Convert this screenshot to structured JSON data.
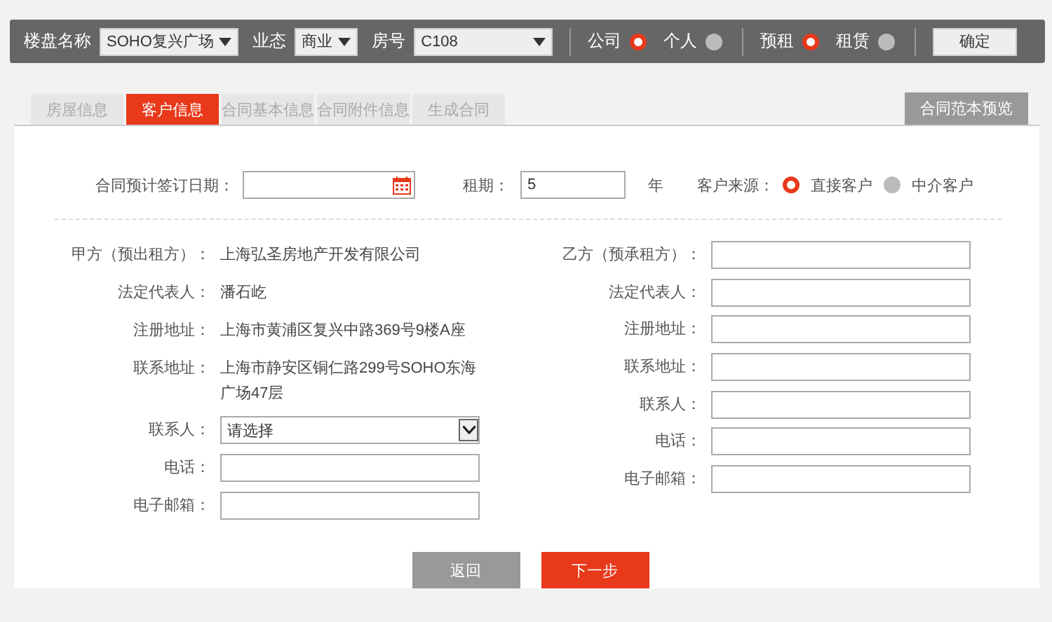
{
  "toolbar": {
    "fields": [
      {
        "label": "楼盘名称",
        "value": "SOHO复兴广场"
      },
      {
        "label": "业态",
        "value": "商业"
      },
      {
        "label": "房号",
        "value": "C108"
      }
    ],
    "radio_groups": [
      [
        {
          "label": "公司",
          "selected": true
        },
        {
          "label": "个人",
          "selected": false
        }
      ],
      [
        {
          "label": "预租",
          "selected": true
        },
        {
          "label": "租赁",
          "selected": false
        }
      ]
    ],
    "confirm_button": "确定"
  },
  "tabs": [
    {
      "label": "房屋信息",
      "selected": false
    },
    {
      "label": "客户信息",
      "selected": true
    },
    {
      "label": "合同基本信息",
      "selected": false
    },
    {
      "label": "合同附件信息",
      "selected": false
    },
    {
      "label": "生成合同",
      "selected": false
    }
  ],
  "preview_button": "合同范本预览",
  "form": {
    "date_label": "合同预计签订日期：",
    "term_label": "租期：",
    "term_value": "5",
    "term_unit": "年",
    "source_label": "客户来源：",
    "source_options": [
      {
        "label": "直接客户",
        "selected": true
      },
      {
        "label": "中介客户",
        "selected": false
      }
    ]
  },
  "party_a": [
    {
      "kind": "text",
      "label": "甲方（预出租方）：",
      "value": "上海弘圣房地产开发有限公司"
    },
    {
      "kind": "text",
      "label": "法定代表人：",
      "value": "潘石屹"
    },
    {
      "kind": "text",
      "label": "注册地址：",
      "value": "上海市黄浦区复兴中路369号9楼A座"
    },
    {
      "kind": "text",
      "label": "联系地址：",
      "value": "上海市静安区铜仁路299号SOHO东海广场47层"
    },
    {
      "kind": "select",
      "label": "联系人：",
      "value": "请选择"
    },
    {
      "kind": "input",
      "label": "电话："
    },
    {
      "kind": "input",
      "label": "电子邮箱："
    }
  ],
  "party_b": [
    {
      "kind": "input",
      "label": "乙方（预承租方）："
    },
    {
      "kind": "input",
      "label": "法定代表人："
    },
    {
      "kind": "input",
      "label": "注册地址："
    },
    {
      "kind": "input",
      "label": "联系地址："
    },
    {
      "kind": "input",
      "label": "联系人："
    },
    {
      "kind": "input",
      "label": "电话："
    },
    {
      "kind": "input",
      "label": "电子邮箱："
    }
  ],
  "buttons": {
    "back": "返回",
    "next": "下一步"
  }
}
